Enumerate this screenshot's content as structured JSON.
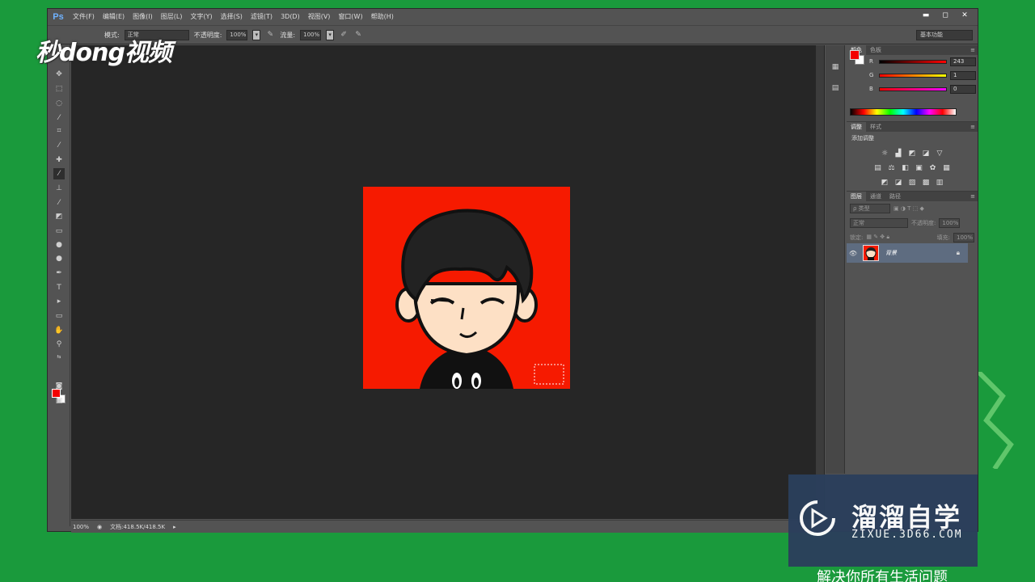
{
  "app": {
    "logo": "Ps"
  },
  "menu": [
    "文件(F)",
    "编辑(E)",
    "图像(I)",
    "图层(L)",
    "文字(Y)",
    "选择(S)",
    "滤镜(T)",
    "3D(D)",
    "视图(V)",
    "窗口(W)",
    "帮助(H)"
  ],
  "window_controls": {
    "minimize": "▬",
    "restore": "◻",
    "close": "✕"
  },
  "options": {
    "mode_label": "模式:",
    "mode_value": "正常",
    "opacity_label": "不透明度:",
    "opacity_value": "100%",
    "flow_label": "流量:",
    "flow_value": "100%",
    "workspace": "基本功能"
  },
  "status": {
    "zoom": "100%",
    "doc": "文档:418.5K/418.5K"
  },
  "color_panel": {
    "tabs": [
      "颜色",
      "色板"
    ],
    "r_label": "R",
    "r_value": "243",
    "g_label": "G",
    "g_value": "1",
    "b_label": "B",
    "b_value": "0",
    "fg_color": "#f30100"
  },
  "adjust_panel": {
    "tabs": [
      "调整",
      "样式"
    ],
    "title": "添加调整"
  },
  "layers_panel": {
    "tabs": [
      "图层",
      "通道",
      "路径"
    ],
    "filter_label": "ρ 类型",
    "blend_mode": "正常",
    "opacity_label": "不透明度:",
    "opacity_value": "100%",
    "lock_label": "锁定:",
    "fill_label": "填充:",
    "fill_value": "100%",
    "layer_name": "背景"
  },
  "brand": {
    "logo_text": "秒dong视频"
  },
  "watermark": {
    "title": "溜溜自学",
    "url": "ZIXUE.3D66.COM"
  },
  "caption": "解决你所有生活问题"
}
